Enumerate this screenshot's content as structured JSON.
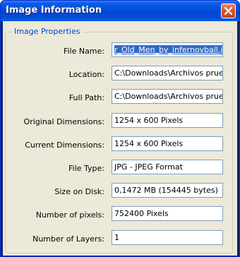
{
  "window": {
    "title": "Image Information"
  },
  "group": {
    "label": "Image Properties"
  },
  "fields": [
    {
      "label": "File Name:",
      "value": "r_Old_Men_by_infernovball.jpg"
    },
    {
      "label": "Location:",
      "value": "C:\\Downloads\\Archivos prueb"
    },
    {
      "label": "Full Path:",
      "value": "C:\\Downloads\\Archivos prueb"
    },
    {
      "label": "Original Dimensions:",
      "value": "1254 x 600 Pixels"
    },
    {
      "label": "Current Dimensions:",
      "value": "1254 x 600 Pixels"
    },
    {
      "label": "File Type:",
      "value": "JPG - JPEG Format"
    },
    {
      "label": "Size on Disk:",
      "value": "0,1472 MB (154445 bytes)"
    },
    {
      "label": "Number of pixels:",
      "value": "752400 Pixels"
    },
    {
      "label": "Number of Layers:",
      "value": "1"
    }
  ],
  "icons": {
    "close": "close-icon"
  },
  "colors": {
    "titlebar": "#0553e0",
    "close_button": "#d9572e",
    "dialog_background": "#ece9d8",
    "group_label": "#0046d5",
    "selection": "#316ac5"
  }
}
